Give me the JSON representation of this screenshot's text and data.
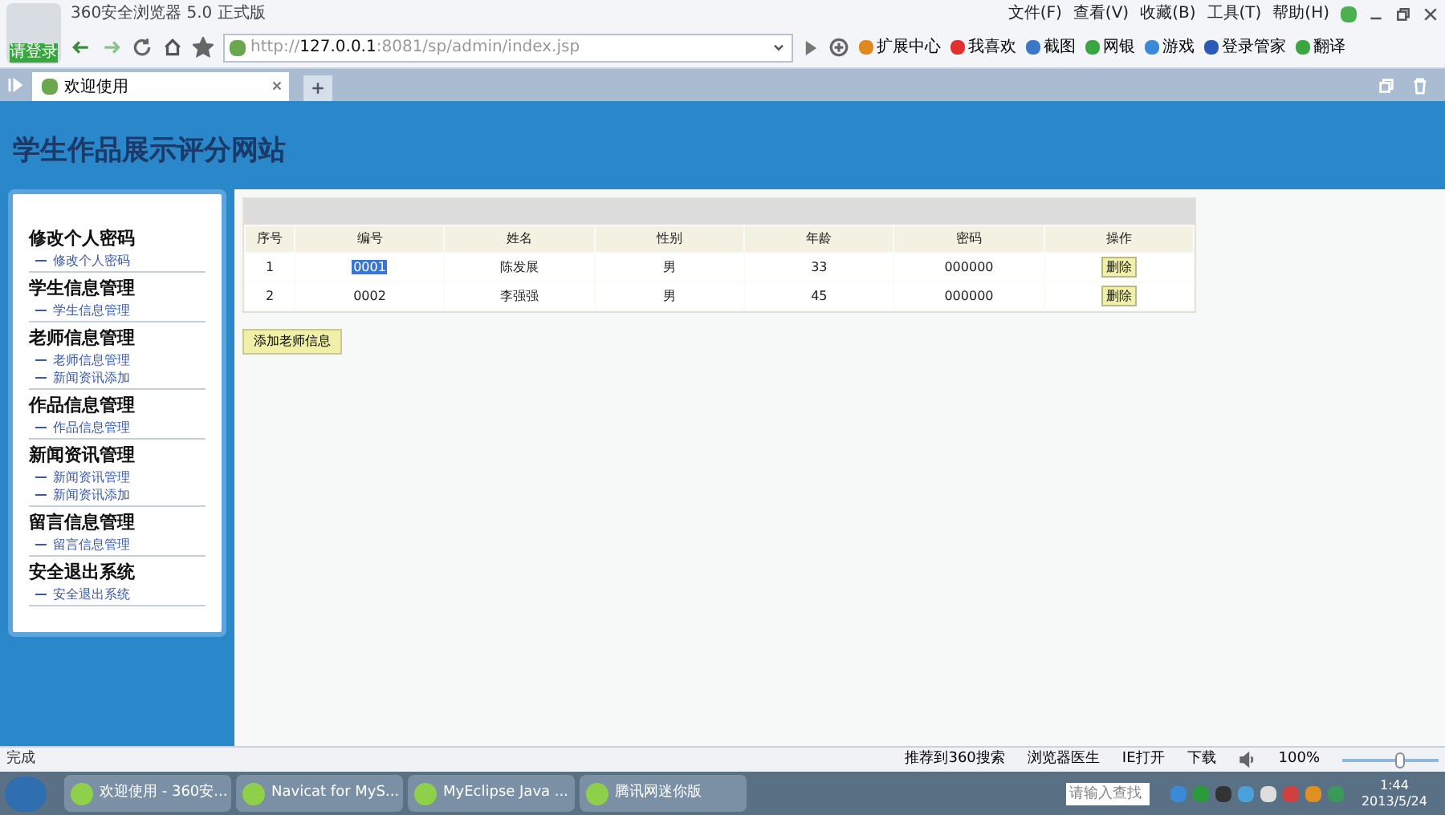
{
  "browser": {
    "title": "360安全浏览器 5.0 正式版",
    "login_label": "请登录",
    "menu": [
      "文件(F)",
      "查看(V)",
      "收藏(B)",
      "工具(T)",
      "帮助(H)"
    ],
    "address": {
      "prefix": "http://",
      "host": "127.0.0.1",
      "rest": ":8081/sp/admin/index.jsp"
    },
    "toolbar": [
      "扩展中心",
      "我喜欢",
      "截图",
      "网银",
      "游戏",
      "登录管家",
      "翻译"
    ],
    "tabs": [
      {
        "label": "欢迎使用",
        "selected": true
      }
    ]
  },
  "page": {
    "site_title": "学生作品展示评分网站",
    "sidebar": [
      {
        "heading": "修改个人密码",
        "links": [
          "修改个人密码"
        ]
      },
      {
        "heading": "学生信息管理",
        "links": [
          "学生信息管理"
        ]
      },
      {
        "heading": "老师信息管理",
        "links": [
          "老师信息管理",
          "新闻资讯添加"
        ]
      },
      {
        "heading": "作品信息管理",
        "links": [
          "作品信息管理"
        ]
      },
      {
        "heading": "新闻资讯管理",
        "links": [
          "新闻资讯管理",
          "新闻资讯添加"
        ]
      },
      {
        "heading": "留言信息管理",
        "links": [
          "留言信息管理"
        ]
      },
      {
        "heading": "安全退出系统",
        "links": [
          "安全退出系统"
        ]
      }
    ],
    "table": {
      "columns": [
        "序号",
        "编号",
        "姓名",
        "性别",
        "年龄",
        "密码",
        "操作"
      ],
      "rows": [
        {
          "cells": [
            "1",
            "0001",
            "陈发展",
            "男",
            "33",
            "000000"
          ],
          "action": "删除",
          "selected": true
        },
        {
          "cells": [
            "2",
            "0002",
            "李强强",
            "男",
            "45",
            "000000"
          ],
          "action": "删除",
          "selected": false
        }
      ]
    },
    "add_button": "添加老师信息"
  },
  "status_bar": {
    "text": "完成",
    "items": [
      "推荐到360搜索",
      "浏览器医生",
      "IE打开",
      "下载"
    ],
    "zoom": "100%",
    "level": 0.62
  },
  "taskbar": {
    "apps": [
      "欢迎使用 - 360安...",
      "Navicat for MyS...",
      "MyEclipse Java ...",
      "腾讯网迷你版"
    ],
    "search_placeholder": "请输入查找",
    "time": "1:44",
    "date": "2013/5/24"
  }
}
